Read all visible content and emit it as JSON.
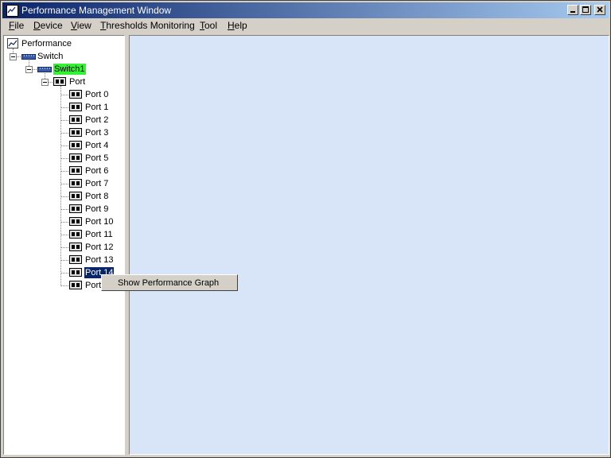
{
  "window": {
    "title": "Performance Management Window"
  },
  "menubar": [
    {
      "mnemonic": "F",
      "rest": "ile"
    },
    {
      "mnemonic": "D",
      "rest": "evice"
    },
    {
      "mnemonic": "V",
      "rest": "iew"
    },
    {
      "mnemonic": "T",
      "rest": "hresholds Monitoring"
    },
    {
      "mnemonic": "T",
      "rest": "ool"
    },
    {
      "mnemonic": "H",
      "rest": "elp"
    }
  ],
  "tree": {
    "root": "Performance",
    "group": "Switch",
    "device": "Switch1",
    "port_group": "Port",
    "ports": [
      "Port 0",
      "Port 1",
      "Port 2",
      "Port 3",
      "Port 4",
      "Port 5",
      "Port 6",
      "Port 7",
      "Port 8",
      "Port 9",
      "Port 10",
      "Port 11",
      "Port 12",
      "Port 13",
      "Port 14",
      "Port"
    ],
    "selected_port": "Port 14",
    "device_highlight_color": "#35f035",
    "selection_color": "#0a246a"
  },
  "context_menu": {
    "item": "Show Performance Graph"
  },
  "icons": {
    "app": "chart-icon",
    "root": "chart-icon",
    "switch": "switch-icon",
    "port": "port-icon",
    "minimize": "minimize-icon",
    "maximize": "maximize-icon",
    "close": "close-icon"
  }
}
